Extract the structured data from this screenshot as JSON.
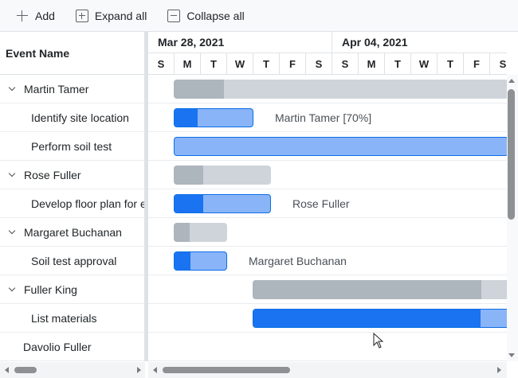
{
  "toolbar": {
    "add_label": "Add",
    "expand_label": "Expand all",
    "collapse_label": "Collapse all",
    "icons": [
      "plus-icon",
      "expand-all-icon",
      "collapse-all-icon"
    ]
  },
  "grid": {
    "header": "Event Name",
    "rows": [
      {
        "label": "Martin Tamer",
        "type": "parent"
      },
      {
        "label": "Identify site location",
        "type": "child"
      },
      {
        "label": "Perform soil test",
        "type": "child"
      },
      {
        "label": "Rose Fuller",
        "type": "parent"
      },
      {
        "label": "Develop floor plan for estimation",
        "type": "child"
      },
      {
        "label": "Margaret Buchanan",
        "type": "parent"
      },
      {
        "label": "Soil test approval",
        "type": "child"
      },
      {
        "label": "Fuller King",
        "type": "parent"
      },
      {
        "label": "List materials",
        "type": "child"
      },
      {
        "label": "Davolio Fuller",
        "type": "leaf"
      }
    ]
  },
  "timeline": {
    "weeks": [
      "Mar 28, 2021",
      "Apr 04, 2021"
    ],
    "days": [
      "S",
      "M",
      "T",
      "W",
      "T",
      "F",
      "S",
      "S",
      "M",
      "T",
      "W",
      "T",
      "F",
      "S"
    ]
  },
  "bars": [
    {
      "row": 0,
      "kind": "parent",
      "progress": 0.15,
      "label": ""
    },
    {
      "row": 1,
      "kind": "child",
      "progress": 0.3,
      "label": "Martin Tamer [70%]"
    },
    {
      "row": 2,
      "kind": "child",
      "progress": 0.0,
      "label": ""
    },
    {
      "row": 3,
      "kind": "parent",
      "progress": 0.3,
      "label": ""
    },
    {
      "row": 4,
      "kind": "child",
      "progress": 0.3,
      "label": "Rose Fuller"
    },
    {
      "row": 5,
      "kind": "parent",
      "progress": 0.3,
      "label": ""
    },
    {
      "row": 6,
      "kind": "child",
      "progress": 0.3,
      "label": "Margaret Buchanan"
    },
    {
      "row": 7,
      "kind": "parent",
      "progress": 0.87,
      "label": ""
    },
    {
      "row": 8,
      "kind": "child",
      "progress": 0.87,
      "label": ""
    }
  ],
  "colors": {
    "parent_bar": "#cfd4da",
    "parent_progress": "#adb5bd",
    "child_bar": "#8ab4f8",
    "child_progress": "#1a73f0"
  }
}
